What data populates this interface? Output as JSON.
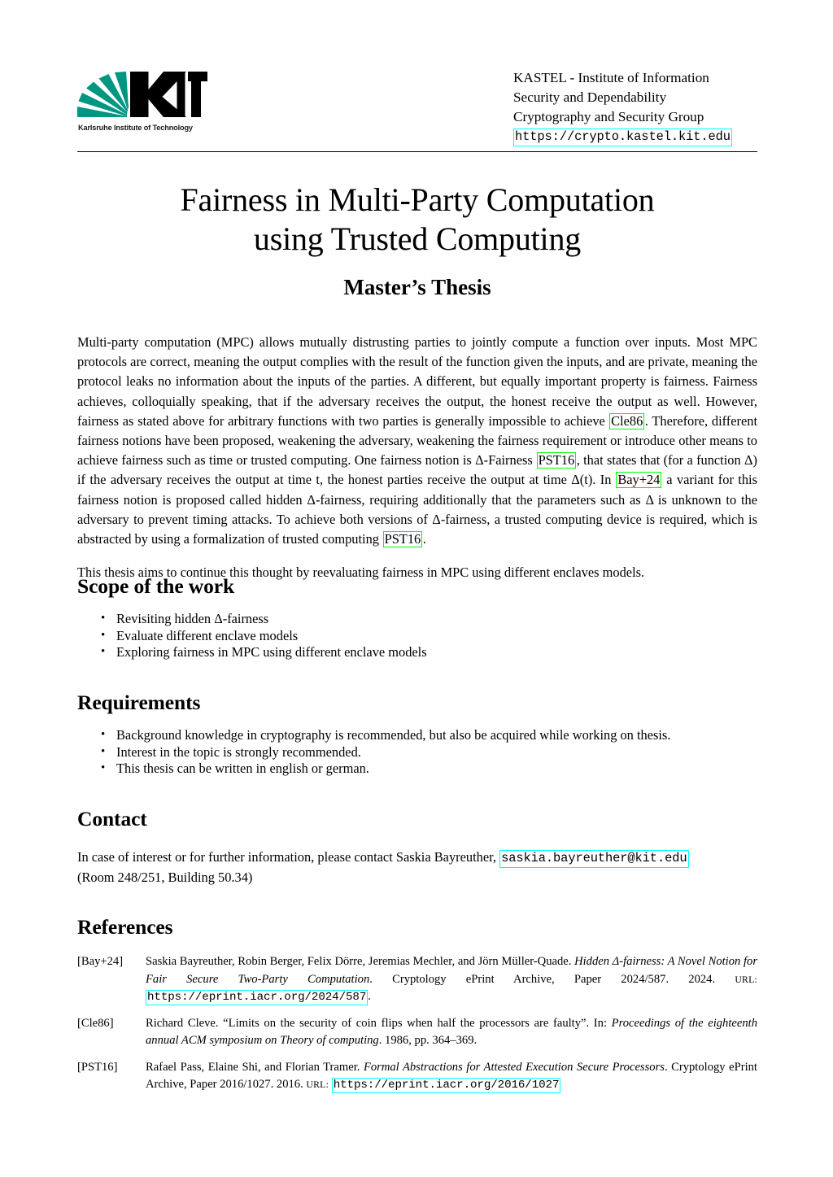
{
  "header": {
    "logo": {
      "letters": "KIT",
      "subtitle": "Karlsruhe Institute of Technology",
      "green": "#009682"
    },
    "institute_lines": [
      "KASTEL - Institute of Information",
      "Security and Dependability",
      "Cryptography and Security Group"
    ],
    "url": "https://crypto.kastel.kit.edu"
  },
  "title": {
    "line1": "Fairness in Multi-Party Computation",
    "line2": "using Trusted Computing",
    "subtitle": "Master’s Thesis"
  },
  "abstract": {
    "p1_a": "Multi-party computation (MPC) allows mutually distrusting parties to jointly compute a function over inputs. Most MPC protocols are correct, meaning the output complies with the result of the function given the inputs, and are private, meaning the protocol leaks no information about the inputs of the parties. A different, but equally important property is fairness. Fairness achieves, colloquially speaking, that if the adversary receives the output, the honest receive the output as well. However, fairness as stated above for arbitrary functions with two parties is generally impossible to achieve ",
    "cite1": "Cle86",
    "p1_b": ". Therefore, different fairness notions have been proposed, weakening the adversary, weakening the fairness requirement or introduce other means to achieve fairness such as time or trusted computing. One fairness notion is Δ-Fairness ",
    "cite2": "PST16",
    "p1_c": ", that states that (for a function Δ) if the adversary receives the output at time t, the honest parties receive the output at time Δ(t). In ",
    "cite3": "Bay+24",
    "p1_d": " a variant for this fairness notion is proposed called hidden Δ-fairness, requiring additionally that the parameters such as Δ is unknown to the adversary to prevent timing attacks. To achieve both versions of Δ-fairness, a trusted computing device is required, which is abstracted by using a formalization of trusted computing ",
    "cite4": "PST16",
    "p1_e": ".",
    "p2": "This thesis aims to continue this thought by reevaluating fairness in MPC using different enclaves models."
  },
  "scope": {
    "heading": "Scope of the work",
    "items": [
      "Revisiting hidden Δ-fairness",
      "Evaluate different enclave models",
      "Exploring fairness in MPC using different enclave models"
    ]
  },
  "requirements": {
    "heading": "Requirements",
    "items": [
      "Background knowledge in cryptography is recommended, but also be acquired while working on thesis.",
      "Interest in the topic is strongly recommended.",
      "This thesis can be written in english or german."
    ]
  },
  "contact": {
    "heading": "Contact",
    "text_before": "In case of interest or for further information, please contact Saskia Bayreuther, ",
    "email": "saskia.bayreuther@kit.edu",
    "text_after": "(Room 248/251, Building 50.34)"
  },
  "references": {
    "heading": "References",
    "entries": [
      {
        "label": "[Bay+24]",
        "text_a": "Saskia Bayreuther, Robin Berger, Felix Dörre, Jeremias Mechler, and Jörn Müller-Quade. ",
        "italic": "Hidden Δ-fairness: A Novel Notion for Fair Secure Two-Party Computation",
        "text_b": ". Cryptology ePrint Archive, Paper 2024/587. 2024. ",
        "url_label": "URL:",
        "url": "https://eprint.iacr.org/2024/587",
        "text_c": "."
      },
      {
        "label": "[Cle86]",
        "text_a": "Richard Cleve. “Limits on the security of coin flips when half the processors are faulty”. In: ",
        "italic": "Proceedings of the eighteenth annual ACM symposium on Theory of computing",
        "text_b": ". 1986, pp. 364–369.",
        "url_label": "",
        "url": "",
        "text_c": ""
      },
      {
        "label": "[PST16]",
        "text_a": "Rafael Pass, Elaine Shi, and Florian Tramer. ",
        "italic": "Formal Abstractions for Attested Execution Secure Processors",
        "text_b": ". Cryptology ePrint Archive, Paper 2016/1027. 2016. ",
        "url_label": "URL:",
        "url": "https://eprint.iacr.org/2016/1027",
        "text_c": ""
      }
    ]
  },
  "colors": {
    "citation_border": "#00ff00",
    "link_border": "#00ffff",
    "kit_green": "#009682"
  }
}
